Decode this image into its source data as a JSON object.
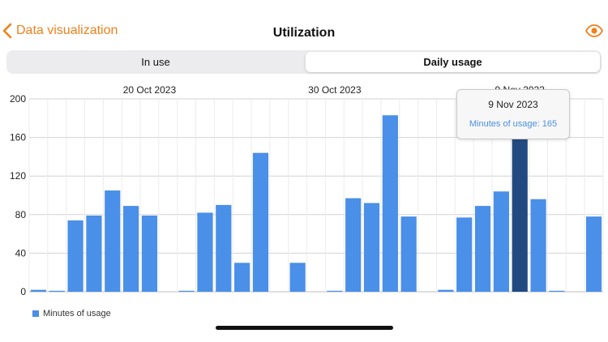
{
  "nav": {
    "back_label": "Data visualization",
    "title": "Utilization",
    "accent_color": "#f0801a",
    "back_icon": "chevron-left-icon",
    "eye_icon": "eye-icon"
  },
  "segments": [
    {
      "label": "In use",
      "selected": false
    },
    {
      "label": "Daily usage",
      "selected": true
    }
  ],
  "tooltip": {
    "date": "9 Nov 2023",
    "value_text": "Minutes of usage: 165"
  },
  "legend": {
    "label": "Minutes of usage",
    "color": "#4a8fe8"
  },
  "chart_data": {
    "type": "bar",
    "series": [
      {
        "name": "Minutes of usage",
        "color": "#4a8fe8",
        "highlight_color": "#234a80",
        "values": [
          2,
          1,
          74,
          79,
          105,
          89,
          79,
          0,
          1,
          82,
          90,
          30,
          144,
          0,
          30,
          0,
          1,
          97,
          92,
          183,
          78,
          0,
          2,
          77,
          89,
          104,
          165,
          96,
          1,
          0,
          78
        ]
      }
    ],
    "highlight_index": 26,
    "date_labels": [
      {
        "index": 6,
        "text": "20 Oct 2023"
      },
      {
        "index": 16,
        "text": "30 Oct 2023"
      },
      {
        "index": 26,
        "text": "9 Nov 2023"
      }
    ],
    "ylim": [
      0,
      200
    ],
    "yticks": [
      0,
      40,
      80,
      120,
      160,
      200
    ],
    "grid": true,
    "legend_position": "bottom-left"
  }
}
